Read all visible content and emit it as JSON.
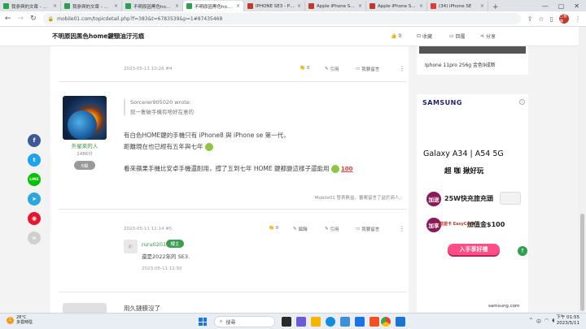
{
  "browser": {
    "tabs": [
      {
        "title": "我參與的文章 - Mobi",
        "fav": "#2e9e4f",
        "active": false
      },
      {
        "title": "我參與的文章 - Mobi",
        "fav": "#2e9e4f",
        "active": false
      },
      {
        "title": "不明原因黑色home",
        "fav": "#2e9e4f",
        "active": false
      },
      {
        "title": "不明原因黑色home",
        "fav": "#2e9e4f",
        "active": true
      },
      {
        "title": "IPHONE SE3 - PCh",
        "fav": "#c0392b",
        "active": false
      },
      {
        "title": "Apple iPhone SE3",
        "fav": "#c0392b",
        "active": false
      },
      {
        "title": "Apple iPhone SE3",
        "fav": "#c0392b",
        "active": false
      },
      {
        "title": "(34) iPhone SE",
        "fav": "#e53935",
        "active": false
      }
    ],
    "url": "mobile01.com/topicdetail.php?f=383&t=6783539&p=1#87435468",
    "profile_label": "已暫停"
  },
  "header": {
    "title": "不明原因黑色home鍵頸油汙污痕",
    "like_count": "0",
    "bookmark_label": "收藏",
    "reply_label": "回覆",
    "share_label": "分享"
  },
  "posts": {
    "post4": {
      "meta": "2023-05-11 10:26 #4",
      "like_count": "0",
      "quote_label": "引用",
      "reply_label": "我要留言"
    },
    "post4_body": {
      "quote_author": "Sorcerer905020 wrote:",
      "quote_text": "就一隻破手機有啥好在意的",
      "line1": "有白色HOME鍵的手機只有 iPhone8 與 iPhone se 第一代，",
      "line2": "距離現在也已經有五年與七年",
      "line3": "看來蘋果手機比安卓手機還耐用，撐了五到七年 HOME 鍵都變這樣子還能用",
      "hundred": "100",
      "signature": "Mobile01 發表無益，審案留言了益於商人。"
    },
    "user4": {
      "name": "外星來的人",
      "points": "1486分",
      "level": "5級"
    },
    "post5": {
      "meta": "2023-05-11 11:14 #5",
      "like_count": "0",
      "edit_label": "編輯",
      "quote_label": "引用",
      "reply_label": "我要留言"
    },
    "reply": {
      "name": "ruru0201",
      "badge": "樓主",
      "text": "還是2022年的 SE3.",
      "time": "2023-05-11 12:50"
    },
    "next_text": "用久鏈膜沒了"
  },
  "sidebar": {
    "top_label": "Iphone 11pro 256g 金色9成新",
    "ad": {
      "brand": "SAMSUNG",
      "model": "Galaxy A34 | A54 5G",
      "slogan": "超  咖 揪好玩",
      "circle1": "加送",
      "promo1": "25W快充旅充頭",
      "circle2": "加享",
      "easycard": "悠遊卡\nEasyCard",
      "promo2": "加值金$100",
      "buy_label": "入手享好禮",
      "site": "samsung.com"
    }
  },
  "taskbar": {
    "temp": "28°C",
    "weather": "多雲時陰",
    "search_label": "搜尋",
    "time": "下午 01:55",
    "date": "2023/5/11",
    "lang": "中"
  }
}
